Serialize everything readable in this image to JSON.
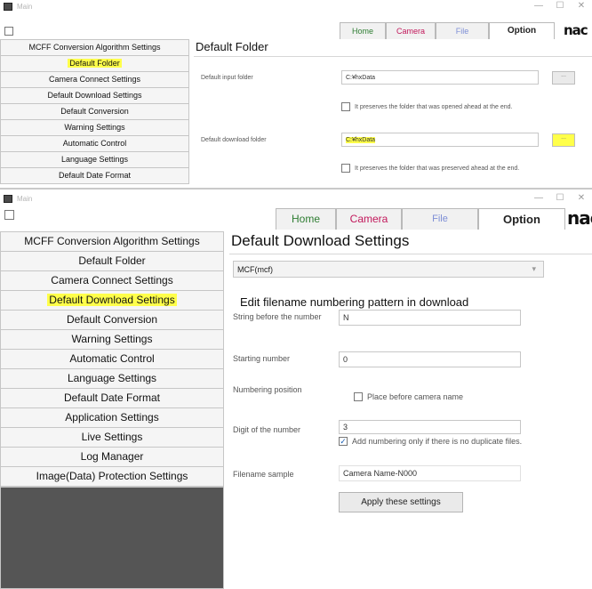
{
  "top_window": {
    "title": "Main",
    "controls": {
      "minimize": "—",
      "maximize": "☐",
      "close": "✕"
    },
    "nav": {
      "home": "Home",
      "camera": "Camera",
      "file": "File",
      "option": "Option"
    },
    "brand": "nac",
    "sidebar": [
      {
        "label": "MCFF Conversion Algorithm Settings",
        "highlighted": false
      },
      {
        "label": "Default Folder",
        "highlighted": true
      },
      {
        "label": "Camera Connect Settings",
        "highlighted": false
      },
      {
        "label": "Default Download Settings",
        "highlighted": false
      },
      {
        "label": "Default Conversion",
        "highlighted": false
      },
      {
        "label": "Warning Settings",
        "highlighted": false
      },
      {
        "label": "Automatic Control",
        "highlighted": false
      },
      {
        "label": "Language Settings",
        "highlighted": false
      },
      {
        "label": "Default Date Format",
        "highlighted": false
      }
    ],
    "content": {
      "title": "Default Folder",
      "input_folder_label": "Default input folder",
      "input_folder_value": "C:¥hxData",
      "input_browse": "...",
      "input_preserve_label": "It preserves the folder that was opened ahead at the end.",
      "download_folder_label": "Default download folder",
      "download_folder_value": "C:¥hxData",
      "download_browse": "...",
      "download_preserve_label": "It preserves the folder that was preserved ahead at the end."
    }
  },
  "bottom_window": {
    "title": "Main",
    "controls": {
      "minimize": "—",
      "maximize": "☐",
      "close": "✕"
    },
    "nav": {
      "home": "Home",
      "camera": "Camera",
      "file": "File",
      "option": "Option"
    },
    "brand": "nac",
    "sidebar": [
      {
        "label": "MCFF Conversion Algorithm Settings",
        "highlighted": false
      },
      {
        "label": "Default Folder",
        "highlighted": false
      },
      {
        "label": "Camera Connect Settings",
        "highlighted": false
      },
      {
        "label": "Default Download Settings",
        "highlighted": true
      },
      {
        "label": "Default Conversion",
        "highlighted": false
      },
      {
        "label": "Warning Settings",
        "highlighted": false
      },
      {
        "label": "Automatic Control",
        "highlighted": false
      },
      {
        "label": "Language Settings",
        "highlighted": false
      },
      {
        "label": "Default Date Format",
        "highlighted": false
      },
      {
        "label": "Application Settings",
        "highlighted": false
      },
      {
        "label": "Live Settings",
        "highlighted": false
      },
      {
        "label": "Log Manager",
        "highlighted": false
      },
      {
        "label": "Image(Data) Protection Settings",
        "highlighted": false
      }
    ],
    "content": {
      "title": "Default Download Settings",
      "format_select": "MCF(mcf)",
      "section_title": "Edit filename numbering pattern in download",
      "string_before_label": "String before the number",
      "string_before_value": "N",
      "starting_number_label": "Starting number",
      "starting_number_value": "0",
      "numbering_position_label": "Numbering position",
      "place_before_label": "Place before camera name",
      "digit_label": "Digit of the number",
      "digit_value": "3",
      "no_duplicate_label": "Add numbering only if there is no duplicate files.",
      "filename_sample_label": "Filename sample",
      "filename_sample_value": "Camera Name-N000",
      "apply_button": "Apply these settings"
    }
  },
  "colors": {
    "highlight": "#ffff4a",
    "home": "#2e7d32",
    "camera": "#c2185b",
    "file": "#7e8fd6",
    "sidebar_fill": "#555555"
  }
}
